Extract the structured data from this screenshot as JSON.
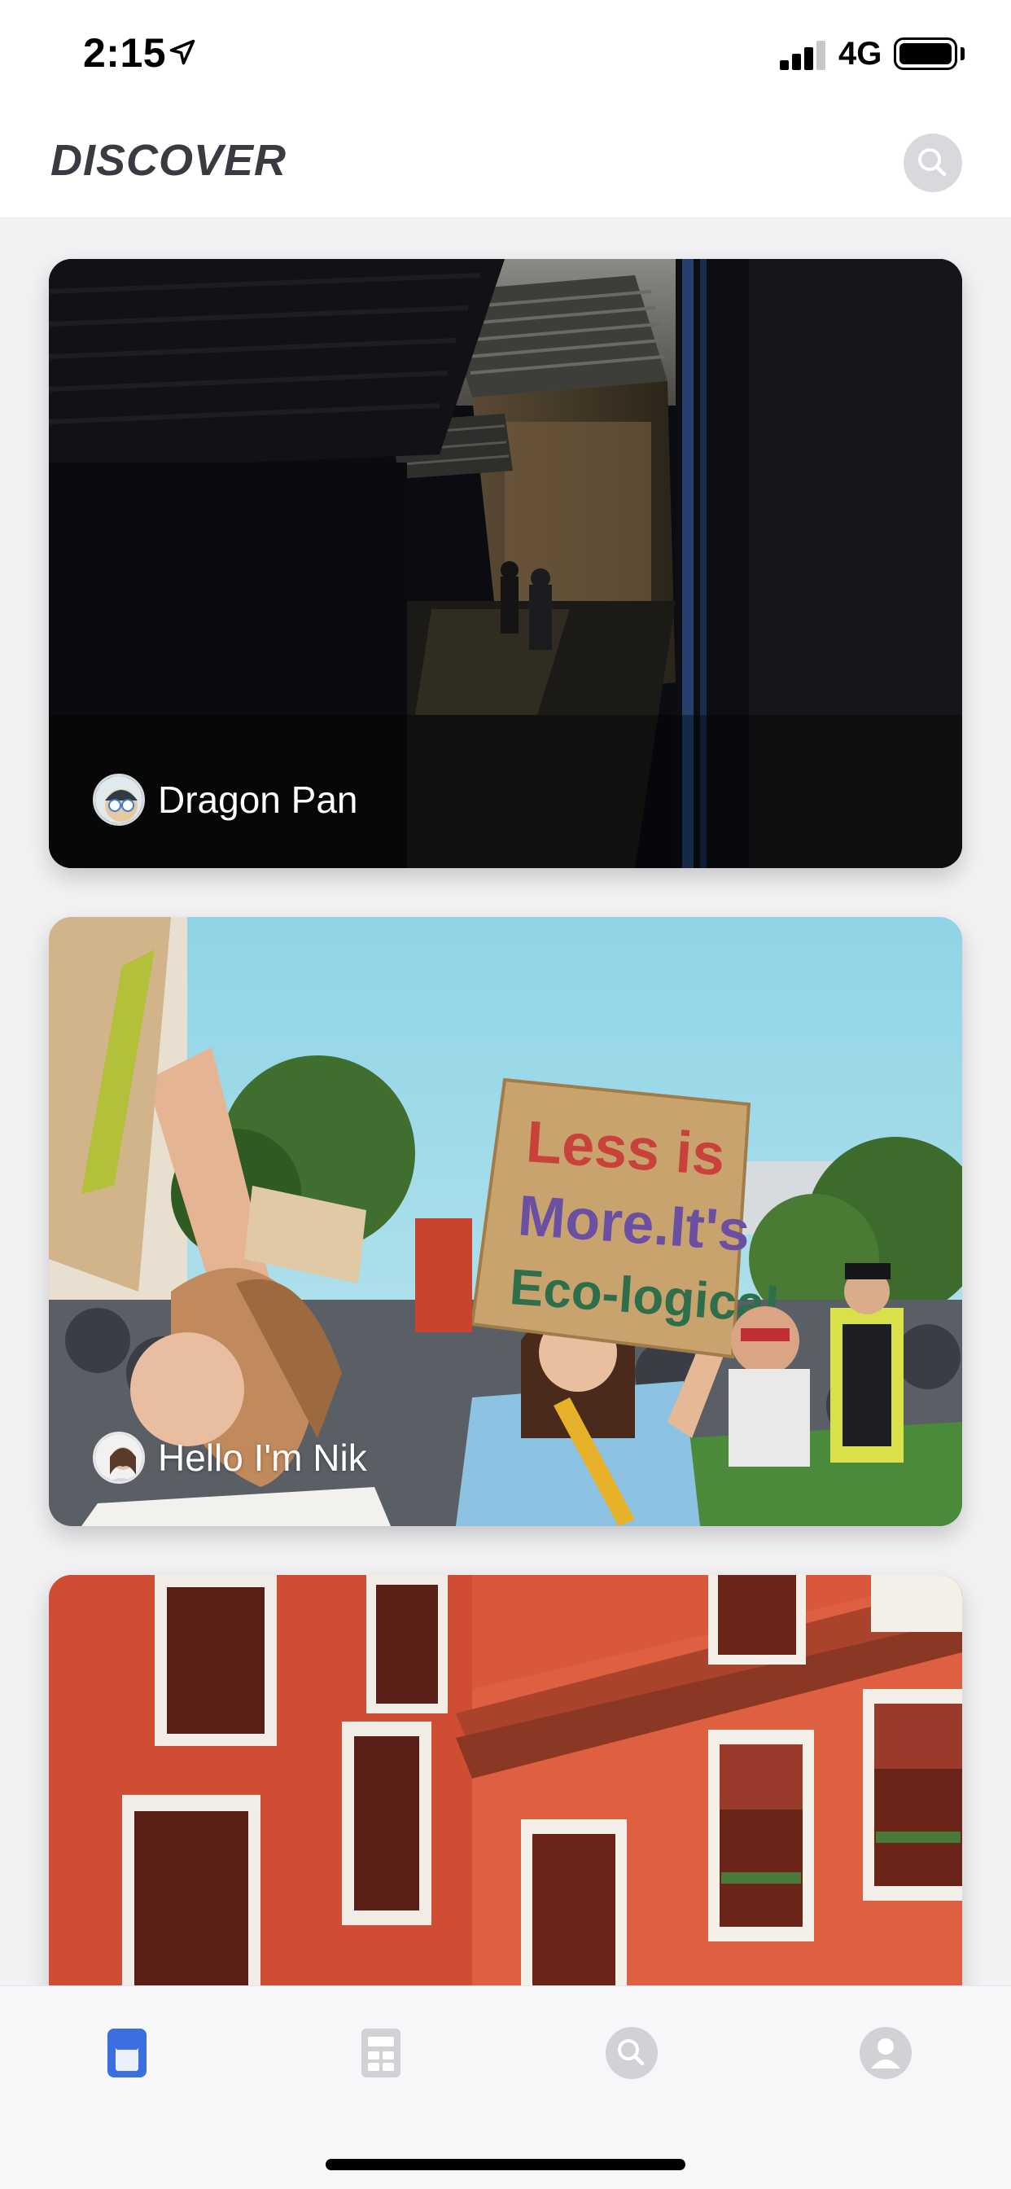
{
  "status_bar": {
    "time": "2:15",
    "network": "4G",
    "icons": [
      "location-arrow-icon",
      "signal-icon",
      "battery-icon"
    ]
  },
  "header": {
    "title": "DISCOVER",
    "search_icon": "search-icon"
  },
  "feed": {
    "cards": [
      {
        "author": "Dragon Pan",
        "scene": "dark alley with tiled rooftops"
      },
      {
        "author": "Hello I'm Nik",
        "scene": "climate protest crowd",
        "sign_text": [
          "Less is",
          "More.It's",
          "Eco-logical"
        ]
      },
      {
        "author": "",
        "scene": "red-orange apartment building facade"
      }
    ]
  },
  "tab_bar": {
    "tabs": [
      {
        "icon": "discover-tab-icon",
        "active": true
      },
      {
        "icon": "grid-tab-icon",
        "active": false
      },
      {
        "icon": "search-tab-icon",
        "active": false
      },
      {
        "icon": "profile-tab-icon",
        "active": false
      }
    ],
    "active_color": "#3b6fe0",
    "inactive_color": "#cfcfd3"
  }
}
